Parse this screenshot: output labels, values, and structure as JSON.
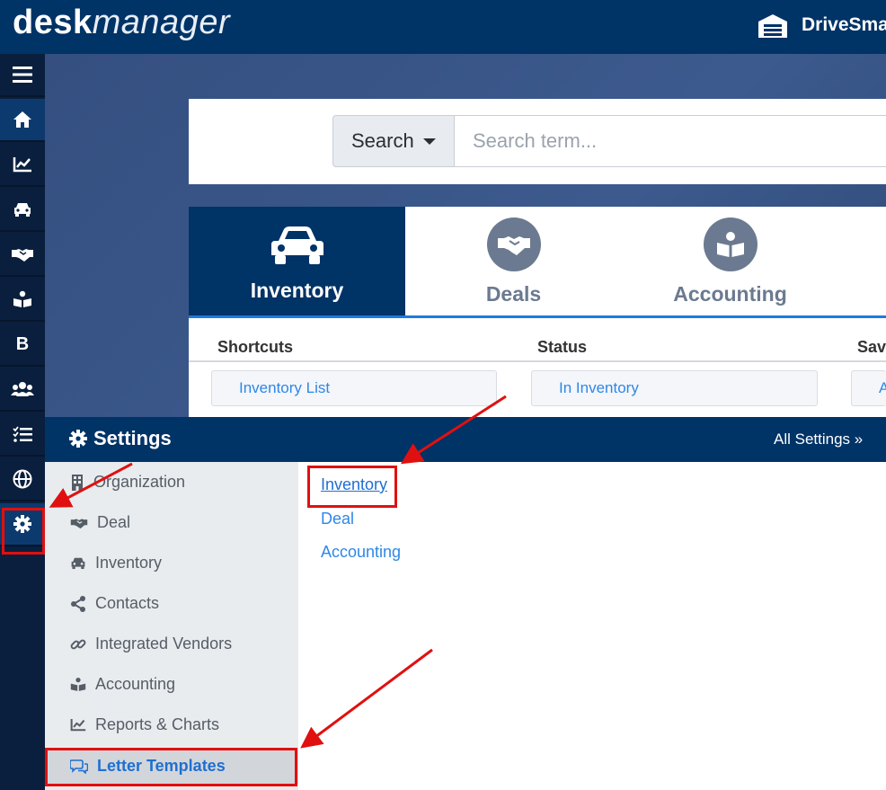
{
  "app": {
    "logo_bold": "desk",
    "logo_italic": "manager",
    "dealer_name": "DriveSma"
  },
  "rail": {
    "items": [
      {
        "icon": "menu-icon"
      },
      {
        "icon": "home-icon",
        "active": true
      },
      {
        "icon": "chart-line-icon"
      },
      {
        "icon": "car-icon"
      },
      {
        "icon": "handshake-icon"
      },
      {
        "icon": "book-reader-icon"
      },
      {
        "icon": "b-letter-icon",
        "text": "B"
      },
      {
        "icon": "users-icon"
      },
      {
        "icon": "tasks-icon"
      },
      {
        "icon": "globe-icon"
      },
      {
        "icon": "gear-icon"
      }
    ]
  },
  "search": {
    "dropdown_label": "Search",
    "placeholder": "Search term..."
  },
  "modules": {
    "tabs": [
      {
        "label": "Inventory",
        "icon": "car-icon",
        "active": true
      },
      {
        "label": "Deals",
        "icon": "handshake-icon"
      },
      {
        "label": "Accounting",
        "icon": "book-reader-icon"
      }
    ]
  },
  "columns": {
    "shortcuts": {
      "title": "Shortcuts",
      "items": [
        "Inventory List"
      ]
    },
    "status": {
      "title": "Status",
      "items": [
        "In Inventory"
      ]
    },
    "saved": {
      "title": "Sav",
      "items": [
        "A"
      ]
    }
  },
  "settings": {
    "title": "Settings",
    "all_link": "All Settings »",
    "menu": [
      {
        "label": "Organization",
        "icon": "building-icon"
      },
      {
        "label": "Deal",
        "icon": "handshake-icon"
      },
      {
        "label": "Inventory",
        "icon": "car-icon"
      },
      {
        "label": "Contacts",
        "icon": "share-icon"
      },
      {
        "label": "Integrated Vendors",
        "icon": "link-icon"
      },
      {
        "label": "Accounting",
        "icon": "book-reader-icon"
      },
      {
        "label": "Reports & Charts",
        "icon": "chart-line-icon"
      },
      {
        "label": "Letter Templates",
        "icon": "comments-icon",
        "active": true
      }
    ],
    "links": [
      "Inventory",
      "Deal",
      "Accounting"
    ]
  },
  "colors": {
    "navy": "#003366",
    "rail": "#0a1f3d",
    "link": "#2f87e8",
    "annotation_red": "#e01010"
  }
}
